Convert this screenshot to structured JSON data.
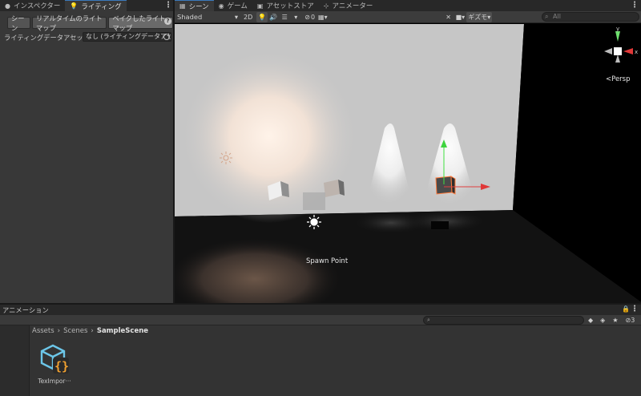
{
  "left_panel": {
    "tabs": [
      {
        "icon": "info-icon",
        "label": "インスペクター"
      },
      {
        "icon": "lightbulb-icon",
        "label": "ライティング"
      }
    ],
    "subtabs": [
      "シーン",
      "リアルタイムのライトマップ",
      "ベイクしたライトマップ"
    ],
    "selected_subtab": "ベイクしたライトマップ",
    "asset_label": "ライティングデータアセット",
    "asset_value": "なし (ライティングデータアセット"
  },
  "scene_panel": {
    "tabs": [
      {
        "icon": "grid-icon",
        "label": "シーン"
      },
      {
        "icon": "gamepad-icon",
        "label": "ゲーム"
      },
      {
        "icon": "store-icon",
        "label": "アセットストア"
      },
      {
        "icon": "animator-icon",
        "label": "アニメーター"
      }
    ],
    "toolbar": {
      "shading_mode": "Shaded",
      "mode_2d": "2D",
      "hidden_count": "0",
      "gizmos": "ギズモ",
      "search_placeholder": "All"
    },
    "persp_label": "<Persp",
    "spawn_point_label": "Spawn Point"
  },
  "animation_bar": {
    "title": "アニメーション"
  },
  "project": {
    "breadcrumb": [
      "Assets",
      "Scenes",
      "SampleScene"
    ],
    "hidden_packages": "3",
    "asset": {
      "name": "TexImpor···",
      "icon": "script-cube-icon"
    }
  },
  "colors": {
    "accent": "#3a79bb",
    "panel_bg": "#383838",
    "scene_wall": "#c9c9c9",
    "scene_floor": "#121212"
  }
}
